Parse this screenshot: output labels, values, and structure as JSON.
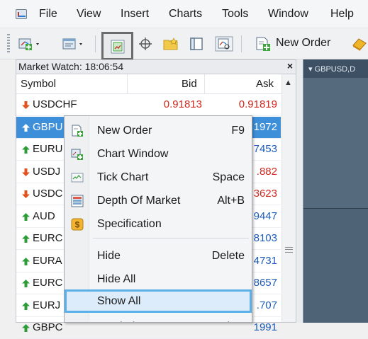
{
  "menubar": {
    "items": [
      "File",
      "View",
      "Insert",
      "Charts",
      "Tools",
      "Window",
      "Help"
    ]
  },
  "toolbar": {
    "new_order_label": "New Order",
    "buttons": [
      "new-chart-icon",
      "profiles-icon",
      "autoscroll-icon",
      "crosshair-icon",
      "folder-star-icon",
      "navigator-icon",
      "zoom-chart-icon",
      "new-order-icon",
      "expert-icon"
    ]
  },
  "market_watch": {
    "title": "Market Watch: 18:06:54",
    "close_glyph": "×",
    "columns": {
      "symbol": "Symbol",
      "bid": "Bid",
      "ask": "Ask"
    },
    "rows": [
      {
        "symbol": "USDCHF",
        "bid": "0.91813",
        "ask": "0.91819",
        "direction": "down",
        "selected": false
      },
      {
        "symbol": "GBPU",
        "bid": "",
        "ask": "1972",
        "direction": "up",
        "selected": true
      },
      {
        "symbol": "EURU",
        "bid": "",
        "ask": "7453",
        "direction": "up",
        "selected": false
      },
      {
        "symbol": "USDJ",
        "bid": "",
        "ask": ".882",
        "direction": "down",
        "selected": false
      },
      {
        "symbol": "USDC",
        "bid": "",
        "ask": "3623",
        "direction": "down",
        "selected": false
      },
      {
        "symbol": "AUD",
        "bid": "",
        "ask": "9447",
        "direction": "up",
        "selected": false
      },
      {
        "symbol": "EURC",
        "bid": "",
        "ask": "8103",
        "direction": "up",
        "selected": false
      },
      {
        "symbol": "EURA",
        "bid": "",
        "ask": "4731",
        "direction": "up",
        "selected": false
      },
      {
        "symbol": "EURC",
        "bid": "",
        "ask": "8657",
        "direction": "up",
        "selected": false
      },
      {
        "symbol": "EURJ",
        "bid": "",
        "ask": ".707",
        "direction": "up",
        "selected": false
      },
      {
        "symbol": "GBPC",
        "bid": "",
        "ask": "1991",
        "direction": "up",
        "selected": false
      }
    ]
  },
  "chart": {
    "title": "GBPUSD,D"
  },
  "context_menu": {
    "items": [
      {
        "label": "New Order",
        "shortcut": "F9",
        "icon": "new-order-icon"
      },
      {
        "label": "Chart Window",
        "shortcut": "",
        "icon": "chart-window-icon"
      },
      {
        "label": "Tick Chart",
        "shortcut": "Space",
        "icon": "tick-chart-icon"
      },
      {
        "label": "Depth Of Market",
        "shortcut": "Alt+B",
        "icon": "depth-of-market-icon"
      },
      {
        "label": "Specification",
        "shortcut": "",
        "icon": "specification-icon"
      },
      {
        "label": "Hide",
        "shortcut": "Delete",
        "icon": ""
      },
      {
        "label": "Hide All",
        "shortcut": "",
        "icon": ""
      },
      {
        "label": "Show All",
        "shortcut": "",
        "icon": "",
        "highlighted": true
      },
      {
        "label": "Symbols",
        "shortcut": "Ctrl+U",
        "icon": ""
      }
    ]
  },
  "colors": {
    "bid_red": "#d0281e",
    "ask_blue": "#1d5bb8",
    "down_arrow": "#e0531e",
    "up_arrow": "#2f9c3a",
    "selection": "#3d8fd9"
  }
}
